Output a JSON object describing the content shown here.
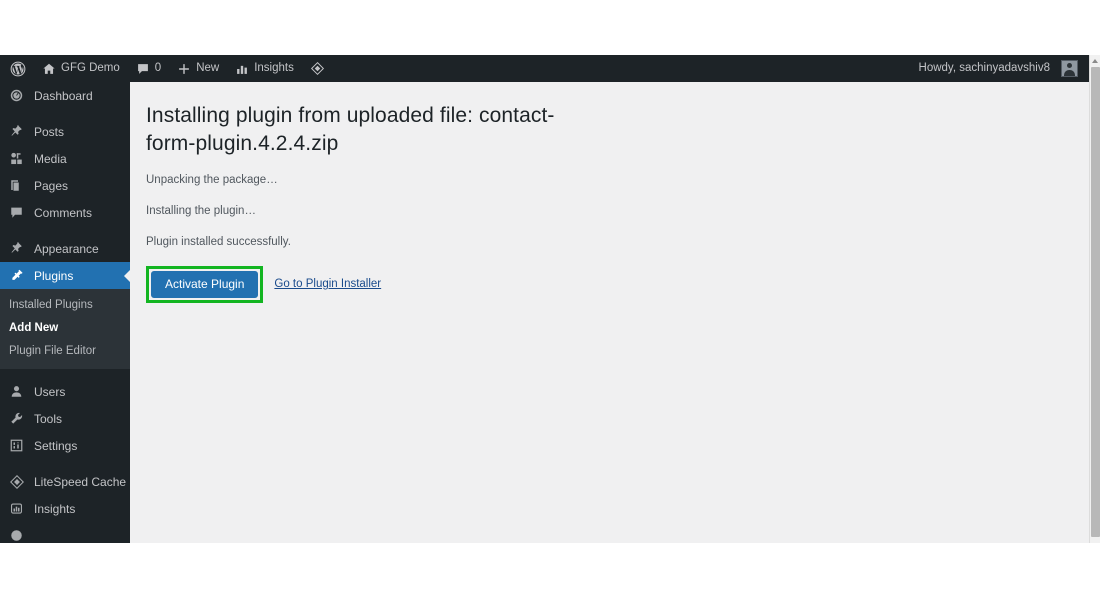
{
  "adminbar": {
    "wp_logo_icon": "wordpress-logo-icon",
    "site": {
      "label": "GFG Demo",
      "icon": "home-icon"
    },
    "comments": {
      "count": "0",
      "icon": "comment-bubble-icon"
    },
    "new": {
      "label": "New",
      "icon": "plus-icon"
    },
    "insights": {
      "label": "Insights",
      "icon": "bar-chart-icon"
    },
    "litespeed": {
      "icon": "litespeed-diamond-icon"
    },
    "account": {
      "greeting": "Howdy, sachinyadavshiv8",
      "avatar_icon": "avatar-icon"
    }
  },
  "sidebar": {
    "items": [
      {
        "label": "Dashboard",
        "icon": "dashboard-gauge-icon",
        "current": false,
        "gap_before": false
      },
      {
        "label": "Posts",
        "icon": "pin-icon",
        "current": false,
        "gap_before": true
      },
      {
        "label": "Media",
        "icon": "media-icon",
        "current": false,
        "gap_before": false
      },
      {
        "label": "Pages",
        "icon": "pages-icon",
        "current": false,
        "gap_before": false
      },
      {
        "label": "Comments",
        "icon": "comment-bubble-icon",
        "current": false,
        "gap_before": false
      },
      {
        "label": "Appearance",
        "icon": "paintbrush-icon",
        "current": false,
        "gap_before": true
      },
      {
        "label": "Plugins",
        "icon": "plug-icon",
        "current": true,
        "gap_before": false
      }
    ],
    "submenu": [
      {
        "label": "Installed Plugins",
        "current": false
      },
      {
        "label": "Add New",
        "current": true
      },
      {
        "label": "Plugin File Editor",
        "current": false
      }
    ],
    "items_after": [
      {
        "label": "Users",
        "icon": "user-icon",
        "current": false,
        "gap_before": true
      },
      {
        "label": "Tools",
        "icon": "wrench-icon",
        "current": false,
        "gap_before": false
      },
      {
        "label": "Settings",
        "icon": "settings-sliders-icon",
        "current": false,
        "gap_before": false
      },
      {
        "label": "LiteSpeed Cache",
        "icon": "litespeed-diamond-icon",
        "current": false,
        "gap_before": true
      },
      {
        "label": "Insights",
        "icon": "insights-icon",
        "current": false,
        "gap_before": false
      }
    ]
  },
  "main": {
    "title": "Installing plugin from uploaded file: contact-form-plugin.4.2.4.zip",
    "status_lines": [
      "Unpacking the package…",
      "Installing the plugin…",
      "Plugin installed successfully."
    ],
    "activate_button": "Activate Plugin",
    "installer_link": "Go to Plugin Installer"
  },
  "colors": {
    "admin_dark": "#1d2327",
    "submenu_dark": "#2c3338",
    "accent_blue": "#2271b1",
    "content_bg": "#f0f0f1",
    "highlight_green": "#12b521",
    "link_blue": "#1a4b8c"
  }
}
